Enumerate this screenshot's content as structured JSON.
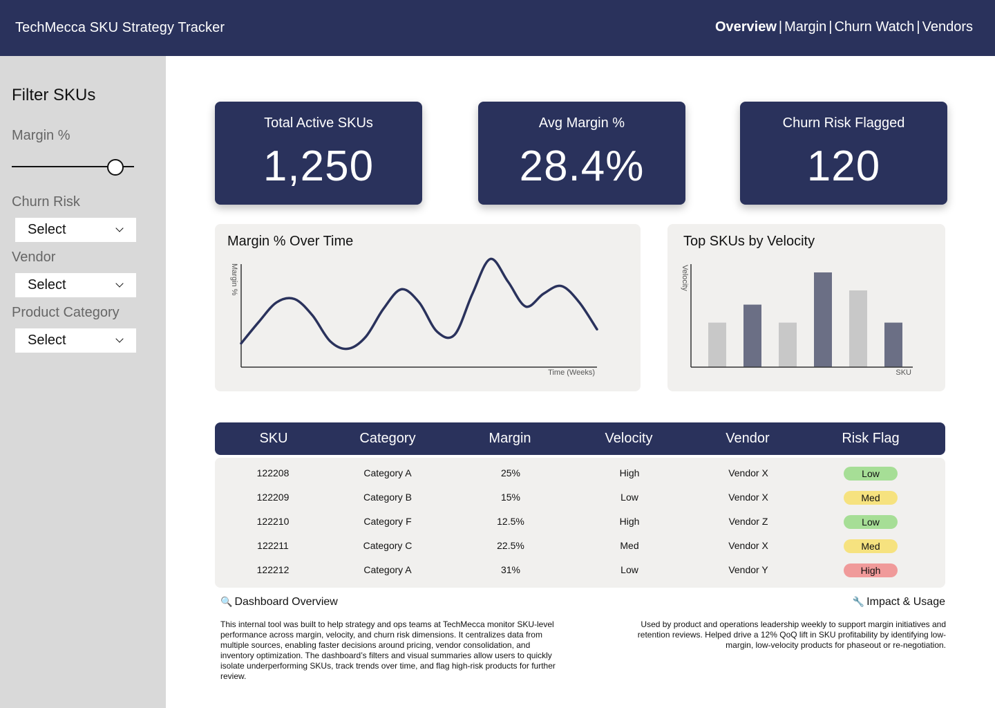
{
  "header": {
    "title": "TechMecca SKU Strategy Tracker",
    "nav": [
      {
        "label": "Overview",
        "active": true
      },
      {
        "label": "Margin",
        "active": false
      },
      {
        "label": "Churn Watch",
        "active": false
      },
      {
        "label": "Vendors",
        "active": false
      }
    ],
    "separator": "|",
    "background": "#2a325c"
  },
  "sidebar": {
    "title": "Filter SKUs",
    "margin_label": "Margin %",
    "margin_slider_value": 0.85,
    "churn_label": "Churn Risk",
    "churn_value": "Select",
    "vendor_label": "Vendor",
    "vendor_value": "Select",
    "category_label": "Product Category",
    "category_value": "Select"
  },
  "kpis": [
    {
      "label": "Total Active SKUs",
      "value": "1,250"
    },
    {
      "label": "Avg Margin %",
      "value": "28.4%"
    },
    {
      "label": "Churn Risk Flagged",
      "value": "120"
    }
  ],
  "chart_data": [
    {
      "type": "line",
      "title": "Margin % Over Time",
      "xlabel": "Time (Weeks)",
      "ylabel": "Margin %",
      "x": [
        0,
        1,
        2,
        3,
        4,
        5,
        6,
        7,
        8,
        9,
        10,
        11,
        12,
        13,
        14,
        15,
        16,
        17,
        18,
        19,
        20
      ],
      "y": [
        22,
        42,
        60,
        63,
        48,
        24,
        17,
        28,
        54,
        72,
        60,
        33,
        30,
        68,
        100,
        79,
        56,
        68,
        75,
        60,
        35
      ],
      "ylim": [
        0,
        110
      ],
      "grid": false,
      "color": "#2a325c"
    },
    {
      "type": "bar",
      "title": "Top SKUs by Velocity",
      "xlabel": "SKU",
      "ylabel": "Velocity",
      "values": [
        47,
        66,
        47,
        100,
        81,
        47
      ],
      "colors": [
        "#c8c8c8",
        "#6b6f85",
        "#c8c8c8",
        "#6b6f85",
        "#c8c8c8",
        "#6b6f85"
      ],
      "ylim": [
        0,
        110
      ],
      "grid": false
    }
  ],
  "table": {
    "headers": [
      "SKU",
      "Category",
      "Margin",
      "Velocity",
      "Vendor",
      "Risk Flag"
    ],
    "rows": [
      {
        "sku": "122208",
        "category": "Category A",
        "margin": "25%",
        "velocity": "High",
        "vendor": "Vendor X",
        "risk": "Low",
        "risk_color": "#a6de96"
      },
      {
        "sku": "122209",
        "category": "Category B",
        "margin": "15%",
        "velocity": "Low",
        "vendor": "Vendor X",
        "risk": "Med",
        "risk_color": "#f6e27f"
      },
      {
        "sku": "122210",
        "category": "Category F",
        "margin": "12.5%",
        "velocity": "High",
        "vendor": "Vendor Z",
        "risk": "Low",
        "risk_color": "#a6de96"
      },
      {
        "sku": "122211",
        "category": "Category C",
        "margin": "22.5%",
        "velocity": "Med",
        "vendor": "Vendor X",
        "risk": "Med",
        "risk_color": "#f6e27f"
      },
      {
        "sku": "122212",
        "category": "Category A",
        "margin": "31%",
        "velocity": "Low",
        "vendor": "Vendor Y",
        "risk": "High",
        "risk_color": "#f09a9a"
      }
    ]
  },
  "footer": {
    "overview_icon": "magnifier-icon",
    "overview_title": "Dashboard Overview",
    "overview_text": "This internal tool was built to help strategy and ops teams at TechMecca monitor SKU-level performance across margin, velocity, and churn risk dimensions. It centralizes data from multiple sources, enabling faster decisions around pricing, vendor consolidation, and inventory optimization. The dashboard’s filters and visual summaries allow users to quickly isolate underperforming SKUs, track trends over time, and flag high-risk products for further review.",
    "impact_icon": "wrench-icon",
    "impact_title": "Impact & Usage",
    "impact_text": "Used by product and operations leadership weekly to support margin initiatives and retention reviews. Helped drive a 12% QoQ lift in SKU profitability by identifying low-margin, low-velocity products for phaseout or re-negotiation."
  }
}
